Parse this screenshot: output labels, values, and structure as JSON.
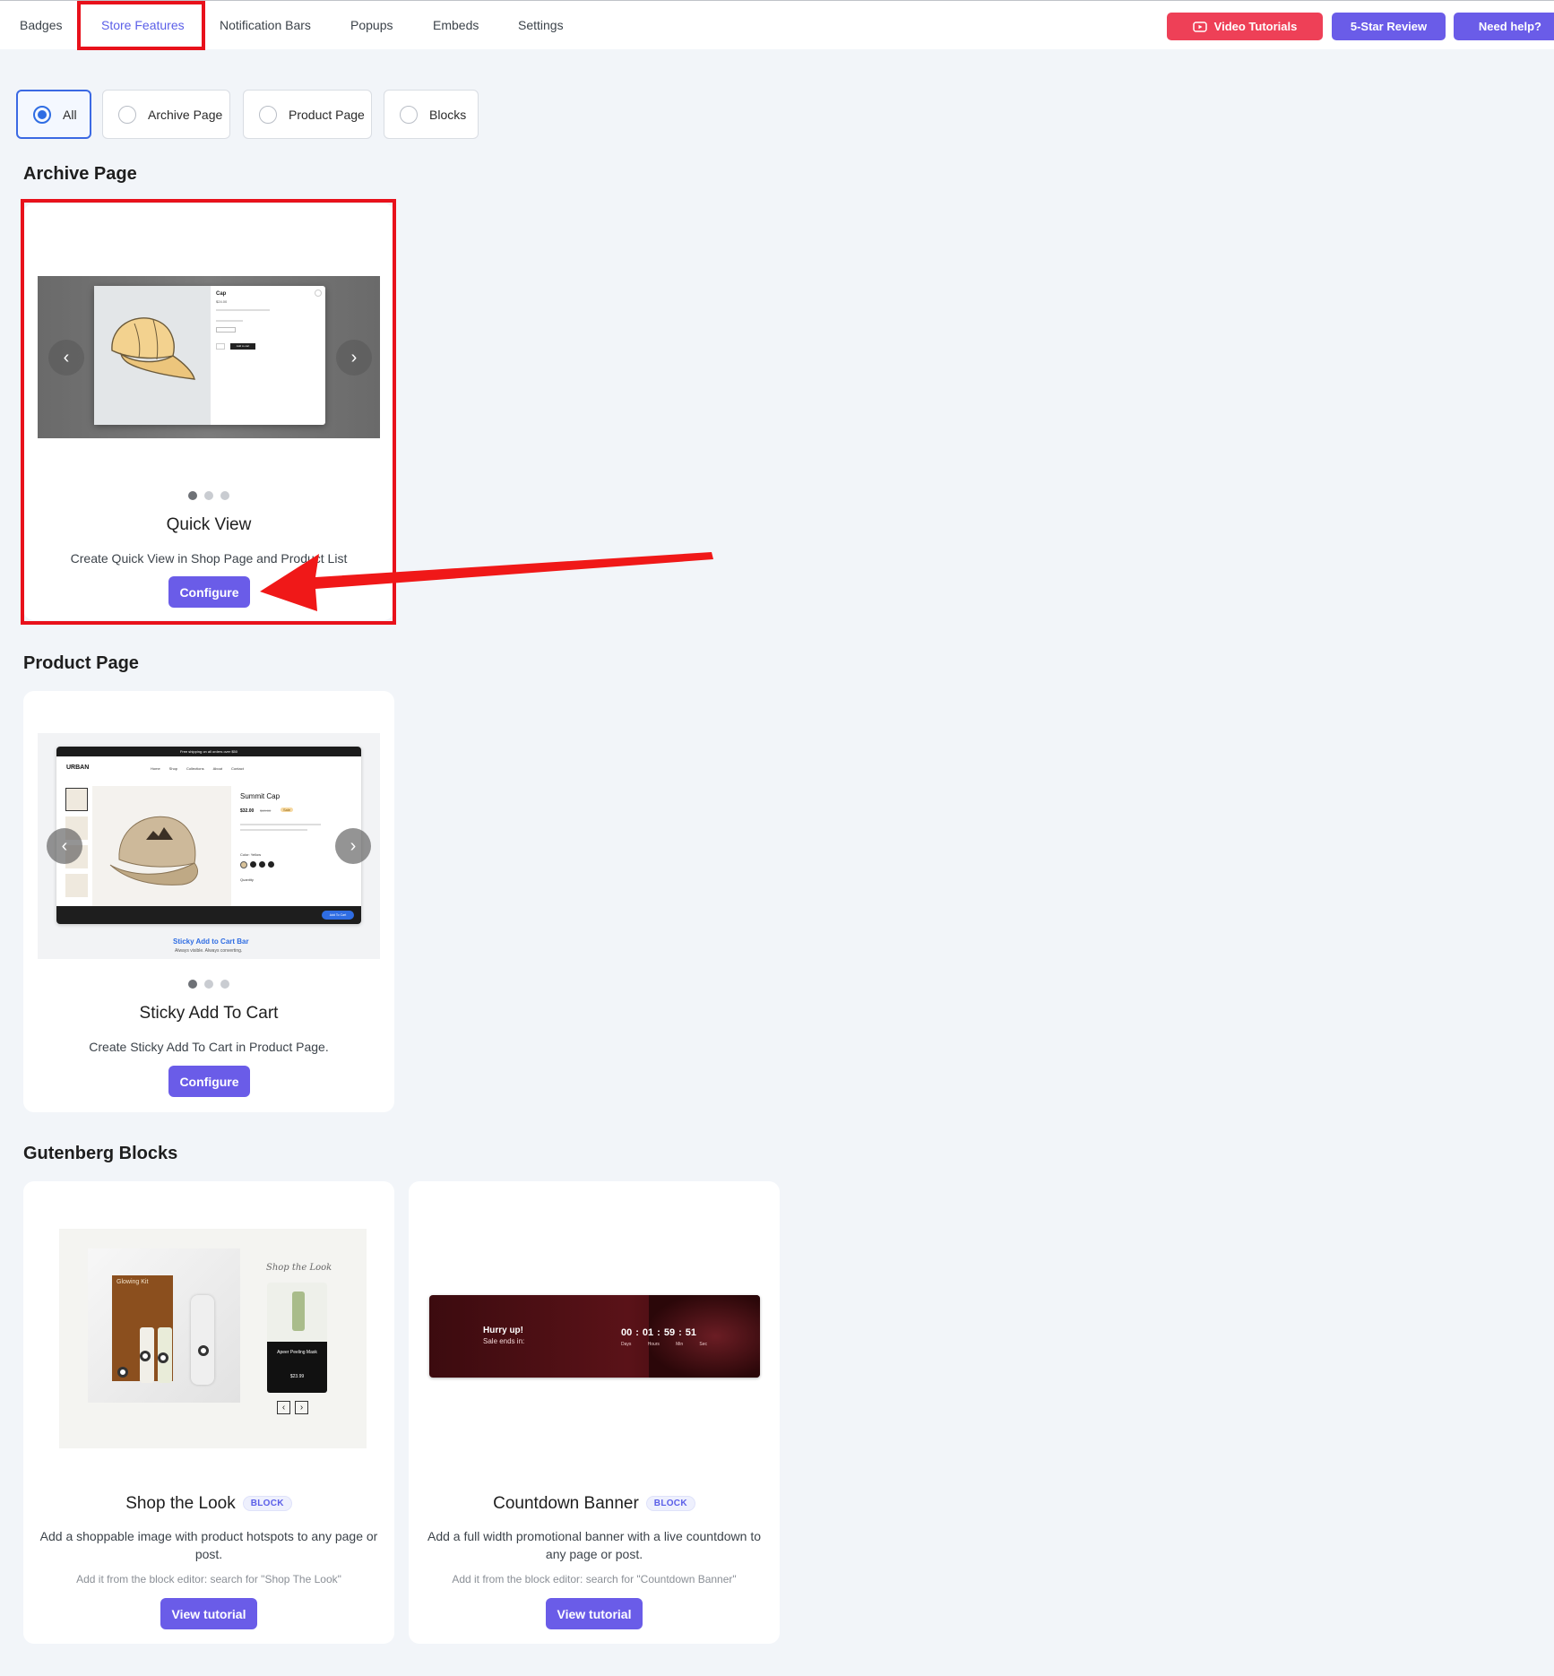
{
  "nav": {
    "tabs": [
      "Badges",
      "Store Features",
      "Notification Bars",
      "Popups",
      "Embeds",
      "Settings"
    ],
    "video_tutorials": "Video Tutorials",
    "review": "5-Star Review",
    "help": "Need help?"
  },
  "filters": [
    "All",
    "Archive Page",
    "Product Page",
    "Blocks"
  ],
  "sections": {
    "archive": "Archive Page",
    "product": "Product Page",
    "gutenberg": "Gutenberg Blocks"
  },
  "quick_view": {
    "title": "Quick View",
    "description": "Create Quick View in Shop Page and Product List",
    "button": "Configure",
    "preview": {
      "product_name": "Cap",
      "price": "$24.00",
      "add_to_cart": "Add to cart"
    }
  },
  "sticky_cart": {
    "title": "Sticky Add To Cart",
    "description": "Create Sticky Add To Cart in Product Page.",
    "button": "Configure",
    "preview": {
      "brand": "URBAN",
      "menu": [
        "Home",
        "Shop",
        "Collections",
        "About",
        "Contact"
      ],
      "product_name": "Summit Cap",
      "price": "$32.00",
      "old_price": "$40.00",
      "sale": "Sale",
      "color_label": "Color: Yellow",
      "quantity_label": "Quantity",
      "bar_add_to_cart": "Add To Cart",
      "caption": "Sticky Add to Cart Bar",
      "caption_sub": "Always visible. Always converting.",
      "announcement": "Free shipping on all orders over $50"
    }
  },
  "shop_look": {
    "title": "Shop the Look",
    "badge": "BLOCK",
    "description": "Add a shoppable image with product hotspots to any page or post.",
    "hint": "Add it from the block editor: search for \"Shop The Look\"",
    "button": "View tutorial",
    "preview": {
      "heading": "Shop the Look",
      "kit": "Glowing Kit",
      "product": "Apeer Peeling Mask",
      "price": "$23.99"
    }
  },
  "countdown": {
    "title": "Countdown Banner",
    "badge": "BLOCK",
    "description": "Add a full width promotional banner with a live countdown to any page or post.",
    "hint": "Add it from the block editor: search for \"Countdown Banner\"",
    "button": "View tutorial",
    "preview": {
      "headline": "Hurry up!",
      "sub": "Sale ends in:",
      "days": "00",
      "hours": "01",
      "mins": "59",
      "secs": "51",
      "days_label": "Days",
      "hours_label": "Hours",
      "mins_label": "Min",
      "secs_label": "Sec"
    }
  },
  "colors": {
    "accent": "#6a5ce8",
    "red": "#ee4057",
    "highlight": "#e8111b"
  }
}
